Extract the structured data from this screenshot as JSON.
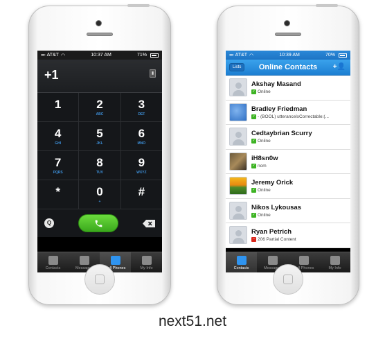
{
  "caption": "next51.net",
  "left_phone": {
    "status": {
      "carrier": "AT&T",
      "time": "10:37 AM",
      "battery": "71%"
    },
    "dial_number": "+1",
    "keypad": [
      [
        {
          "digit": "1",
          "letters": ""
        },
        {
          "digit": "2",
          "letters": "ABC"
        },
        {
          "digit": "3",
          "letters": "DEF"
        }
      ],
      [
        {
          "digit": "4",
          "letters": "GHI"
        },
        {
          "digit": "5",
          "letters": "JKL"
        },
        {
          "digit": "6",
          "letters": "MNO"
        }
      ],
      [
        {
          "digit": "7",
          "letters": "PQRS"
        },
        {
          "digit": "8",
          "letters": "TUV"
        },
        {
          "digit": "9",
          "letters": "WXYZ"
        }
      ],
      [
        {
          "digit": "*",
          "letters": ""
        },
        {
          "digit": "0",
          "letters": "+"
        },
        {
          "digit": "#",
          "letters": ""
        }
      ]
    ],
    "tabs": [
      "Contacts",
      "Messages",
      "Call Phones",
      "My Info"
    ],
    "active_tab": "Call Phones"
  },
  "right_phone": {
    "status": {
      "carrier": "AT&T",
      "time": "10:39 AM",
      "battery": "70%"
    },
    "nav": {
      "lists_label": "Lists",
      "title": "Online Contacts",
      "add_icon": "+"
    },
    "contacts": [
      {
        "name": "Akshay Masand",
        "status": "Online",
        "online": true,
        "avatar": "default"
      },
      {
        "name": "Bradley Friedman",
        "status": "- (BOOL) utterancelsCorrectable:(...",
        "online": true,
        "avatar": "apple"
      },
      {
        "name": "Cedtaybrian Scurry",
        "status": "Online",
        "online": true,
        "avatar": "default"
      },
      {
        "name": "iH8sn0w",
        "status": "nom",
        "online": true,
        "avatar": "photo1"
      },
      {
        "name": "Jeremy Orick",
        "status": "Online",
        "online": true,
        "avatar": "photo2"
      },
      {
        "name": "Nikos Lykousas",
        "status": "Online",
        "online": true,
        "avatar": "default"
      },
      {
        "name": "Ryan Petrich",
        "status": "206 Partial Content",
        "online": false,
        "avatar": "default"
      }
    ],
    "tabs": [
      "Contacts",
      "Messages",
      "Call Phones",
      "My Info"
    ],
    "active_tab": "Contacts"
  },
  "colors": {
    "accent_blue": "#2f94f0",
    "call_green": "#4cc12a",
    "online_green": "#3db323",
    "busy_red": "#d9261c"
  }
}
